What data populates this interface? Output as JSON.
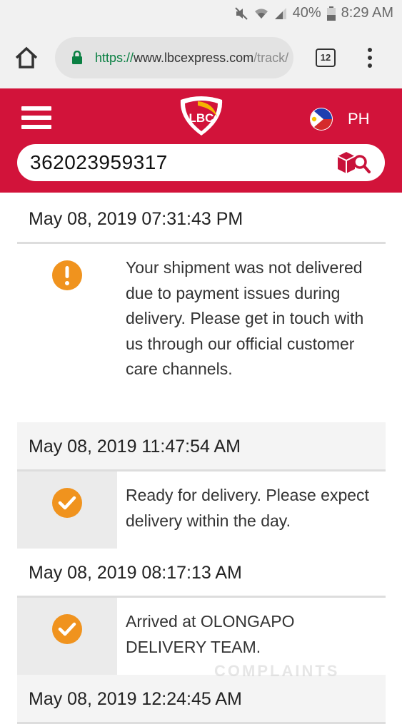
{
  "status_bar": {
    "battery": "40%",
    "time": "8:29 AM"
  },
  "browser": {
    "url_scheme": "https://",
    "url_host": "www.lbcexpress.com",
    "url_path": "/track/",
    "tab_count": "12"
  },
  "header": {
    "logo_text": "LBC",
    "region": "PH",
    "tracking_number": "362023959317"
  },
  "events": [
    {
      "datetime": "May 08, 2019 07:31:43 PM",
      "status": "warning",
      "message": "Your shipment was not delivered due to payment issues during delivery. Please get in touch with us through our official customer care channels."
    },
    {
      "datetime": "May 08, 2019 11:47:54 AM",
      "status": "ok",
      "message": "Ready for delivery. Please expect delivery within the day."
    },
    {
      "datetime": "May 08, 2019 08:17:13 AM",
      "status": "ok",
      "message": "Arrived at OLONGAPO DELIVERY TEAM."
    },
    {
      "datetime": "May 08, 2019 12:24:45 AM",
      "status": "ok",
      "message": ""
    }
  ],
  "watermark": "COMPLAINTS",
  "colors": {
    "brand": "#d2133a",
    "status_orange": "#f0931e"
  }
}
